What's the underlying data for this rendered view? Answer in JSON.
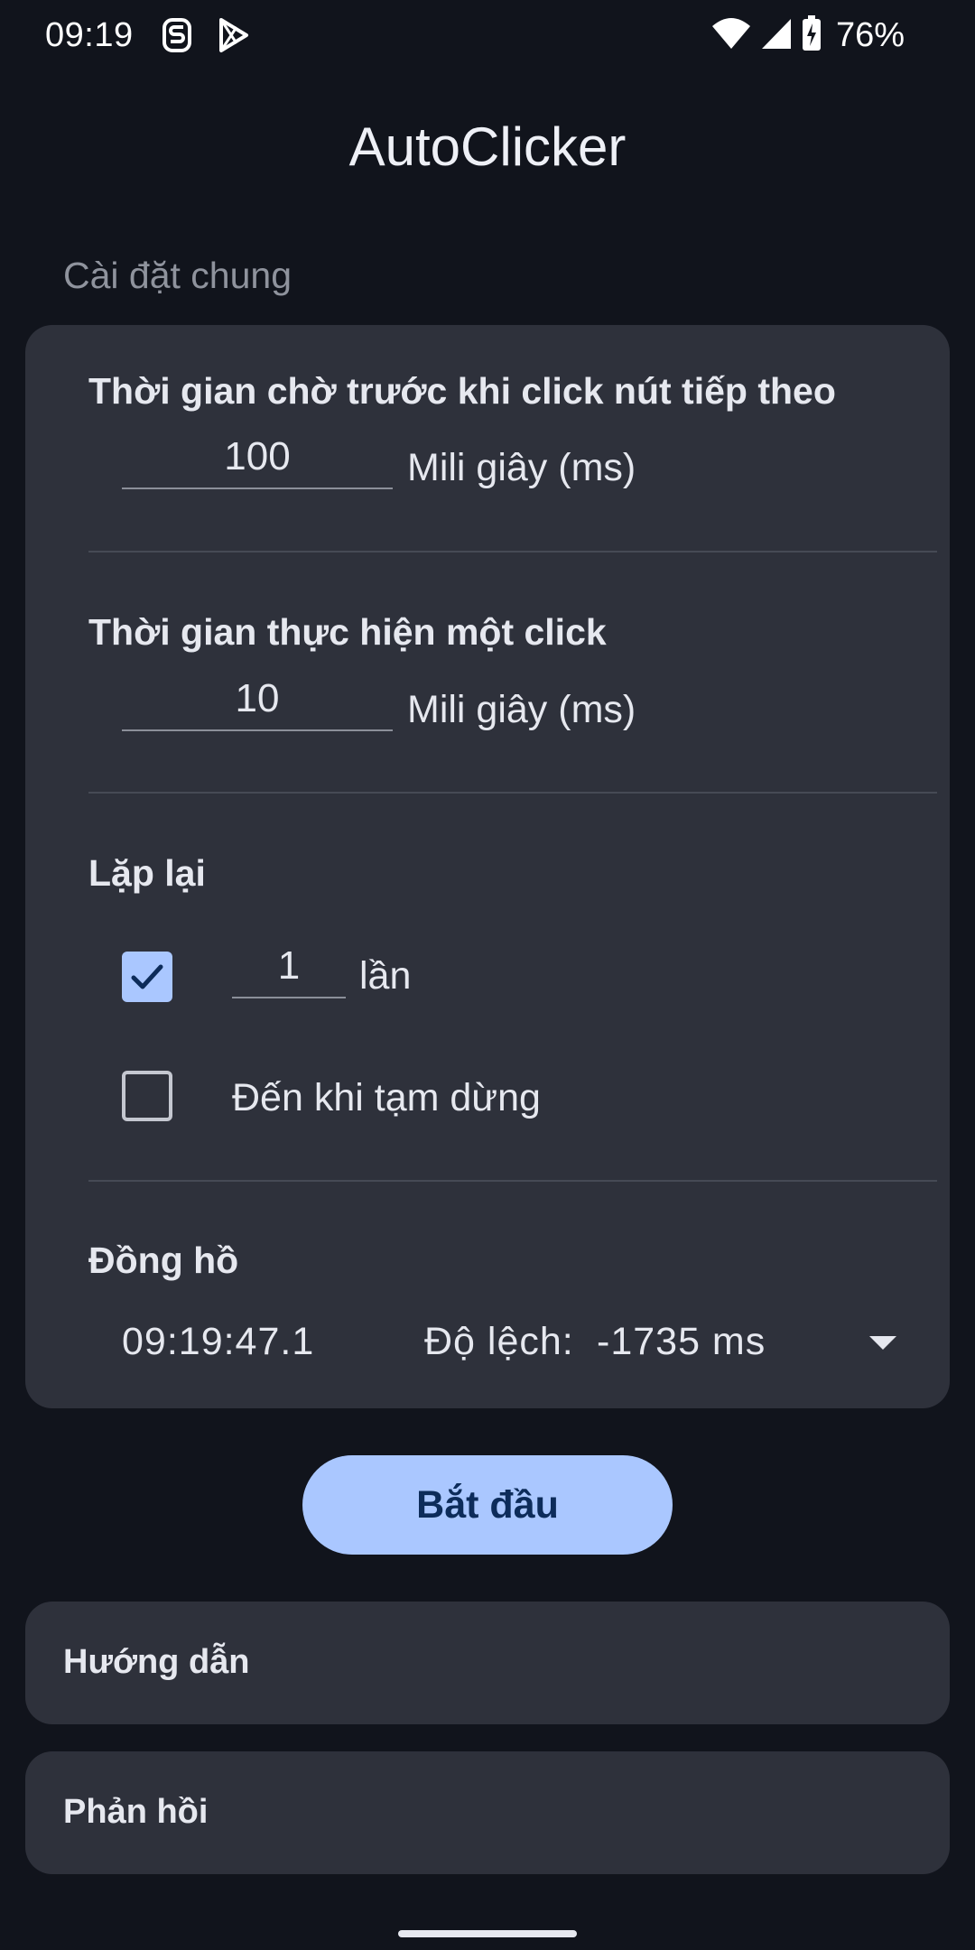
{
  "status_bar": {
    "time": "09:19",
    "icons": [
      "tiktok-s-icon",
      "play-store-icon",
      "wifi-icon",
      "cell-signal-icon",
      "battery-charging-icon"
    ],
    "battery": "76%"
  },
  "app": {
    "title": "AutoClicker"
  },
  "general": {
    "section_title": "Cài đặt chung",
    "delay": {
      "label": "Thời gian chờ trước khi click nút tiếp theo",
      "value": "100",
      "unit": "Mili giây (ms)"
    },
    "duration": {
      "label": "Thời gian thực hiện một click",
      "value": "10",
      "unit": "Mili giây (ms)"
    },
    "repeat": {
      "label": "Lặp lại",
      "times": {
        "checked": true,
        "value": "1",
        "unit": "lần"
      },
      "until_pause": {
        "checked": false,
        "label": "Đến khi tạm dừng"
      }
    },
    "clock": {
      "label": "Đồng hồ",
      "time": "09:19:47.1",
      "offset_label": "Độ lệch:",
      "offset_value": "-1735 ms"
    }
  },
  "start_button": "Bắt đầu",
  "links": {
    "guide": "Hướng dẫn",
    "feedback": "Phản hồi"
  },
  "colors": {
    "background": "#11141c",
    "card": "#2e313b",
    "accent": "#aac7ff",
    "accent_text": "#0d2c5a"
  }
}
